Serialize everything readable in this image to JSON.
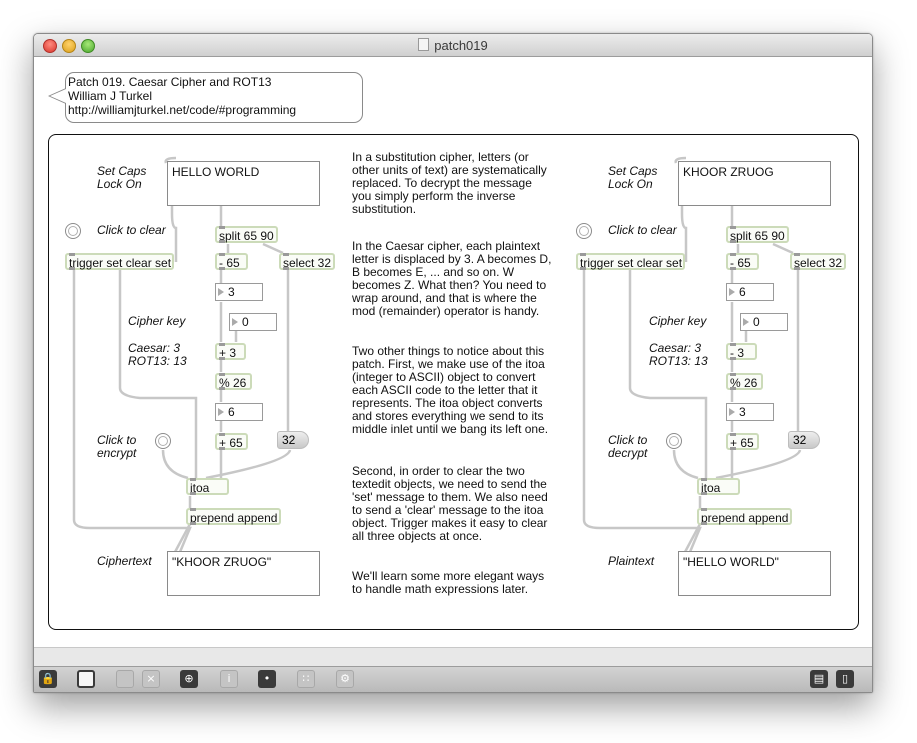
{
  "window": {
    "title": "patch019"
  },
  "header": {
    "line1": "Patch 019. Caesar Cipher and ROT13",
    "line2": "William J Turkel",
    "line3": "http://williamjturkel.net/code/#programming"
  },
  "left": {
    "caps_label_1": "Set Caps",
    "caps_label_2": "Lock On",
    "input_text": "HELLO WORLD",
    "clear_label": "Click to clear",
    "trigger": "trigger set clear set",
    "split": "split 65 90",
    "minus": "- 65",
    "select": "select 32",
    "n1": "3",
    "cipher_key_label": "Cipher key",
    "key_value": "0",
    "caesar_line1": "Caesar: 3",
    "caesar_line2": "ROT13: 13",
    "op1": "+ 3",
    "mod": "% 26",
    "n2": "6",
    "plus": "+ 65",
    "msg32": "32",
    "encrypt_line1": "Click to",
    "encrypt_line2": "encrypt",
    "itoa": "itoa",
    "prepend": "prepend append",
    "out_label": "Ciphertext",
    "output_text": "\"KHOOR ZRUOG\""
  },
  "right": {
    "caps_label_1": "Set Caps",
    "caps_label_2": "Lock On",
    "input_text": "KHOOR ZRUOG",
    "clear_label": "Click to clear",
    "trigger": "trigger set clear set",
    "split": "split 65 90",
    "minus": "- 65",
    "select": "select 32",
    "n1": "6",
    "cipher_key_label": "Cipher key",
    "key_value": "0",
    "caesar_line1": "Caesar: 3",
    "caesar_line2": "ROT13: 13",
    "op1": "- 3",
    "mod": "% 26",
    "n2": "3",
    "plus": "+ 65",
    "msg32": "32",
    "decrypt_line1": "Click to",
    "decrypt_line2": "decrypt",
    "itoa": "itoa",
    "prepend": "prepend append",
    "out_label": "Plaintext",
    "output_text": "\"HELLO WORLD\""
  },
  "notes": {
    "p1": "In a substitution cipher, letters (or other units of text) are systematically replaced. To decrypt the message you simply perform the inverse substitution.",
    "p2": "In the Caesar cipher, each plaintext letter is displaced by 3. A becomes D, B becomes E, ... and so on. W becomes Z. What then? You need to wrap around, and that is where the mod (remainder) operator is handy.",
    "p3": "Two other things to notice about this patch. First, we make use of the itoa (integer to ASCII) object to convert each ASCII code to the letter that it represents. The itoa object converts and stores everything we send to its middle inlet until we bang its left one.",
    "p4": "Second, in order to clear the two textedit objects, we need to send the 'set' message to them. We also need to send a 'clear' message to the itoa object. Trigger makes it easy to clear all three objects at once.",
    "p5": "We'll learn some more elegant ways to handle math expressions later."
  },
  "toolbar": {
    "items": [
      "lock-icon",
      "new-view-icon",
      "patch-cord-icon",
      "delete-icon",
      "presentation-icon",
      "inspector-icon",
      "object-palette-icon",
      "grid-icon",
      "debug-icon",
      "split-horizontal-icon",
      "split-vertical-icon"
    ]
  }
}
